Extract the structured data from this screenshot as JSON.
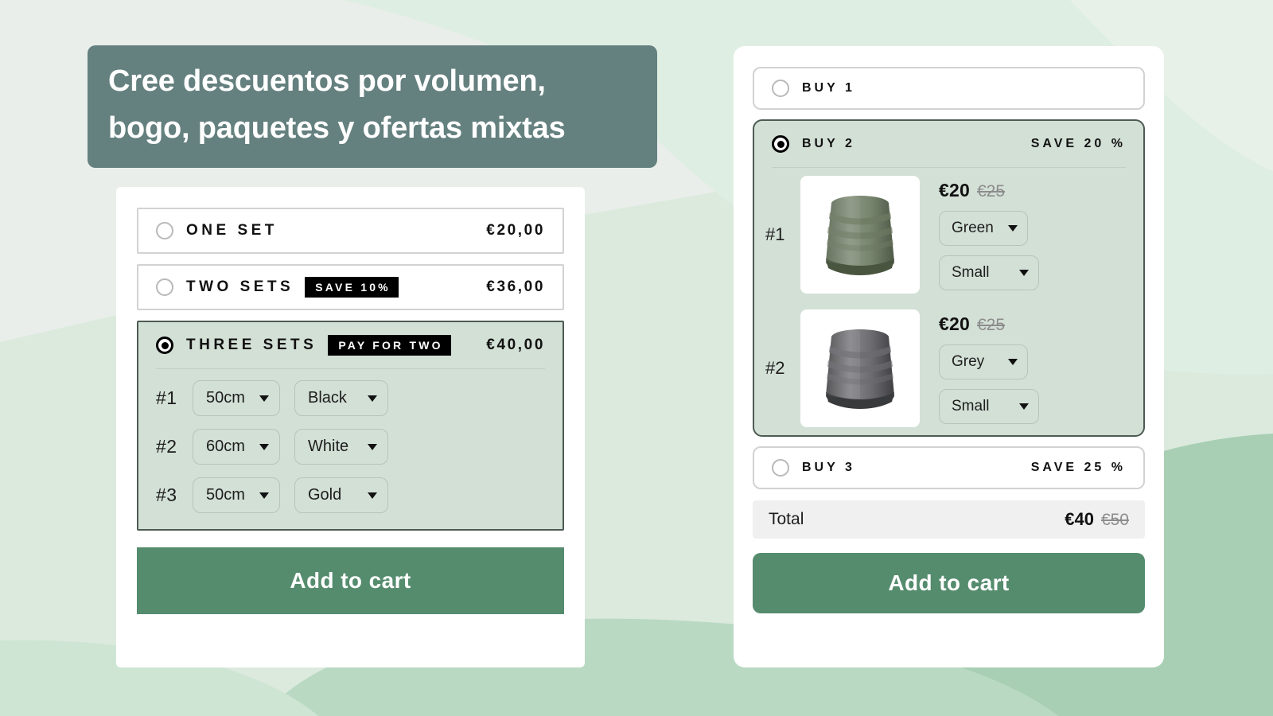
{
  "headline": {
    "line1": "Cree descuentos por volumen,",
    "line2": "bogo, paquetes y ofertas mixtas",
    "bg_color": "#64807f",
    "text_color": "#ffffff"
  },
  "colors": {
    "page_bg": "#e9eeea",
    "accent_green": "#558c6e",
    "selected_panel_bg": "#d3e0d6",
    "selected_border": "#4d5b54",
    "badge_bg": "#000000",
    "total_bg": "#f0f0f0",
    "strikethrough": "#8c8c8c"
  },
  "left_card": {
    "options": [
      {
        "label": "ONE SET",
        "badge": null,
        "price": "€20,00",
        "selected": false
      },
      {
        "label": "TWO SETS",
        "badge": "SAVE 10%",
        "price": "€36,00",
        "selected": false
      },
      {
        "label": "THREE SETS",
        "badge": "PAY FOR TWO",
        "price": "€40,00",
        "selected": true
      }
    ],
    "variant_rows": [
      {
        "num": "#1",
        "size": "50cm",
        "color": "Black"
      },
      {
        "num": "#2",
        "size": "60cm",
        "color": "White"
      },
      {
        "num": "#3",
        "size": "50cm",
        "color": "Gold"
      }
    ],
    "cta_label": "Add to cart"
  },
  "right_card": {
    "options": [
      {
        "label": "BUY 1",
        "save": "",
        "selected": false
      },
      {
        "label": "BUY 2",
        "save": "SAVE 20 %",
        "selected": true
      },
      {
        "label": "BUY 3",
        "save": "SAVE 25 %",
        "selected": false
      }
    ],
    "products": [
      {
        "num": "#1",
        "price_now": "€20",
        "price_was": "€25",
        "color": "Green",
        "size": "Small",
        "image": "green-neck-gaiter"
      },
      {
        "num": "#2",
        "price_now": "€20",
        "price_was": "€25",
        "color": "Grey",
        "size": "Small",
        "image": "grey-neck-gaiter"
      }
    ],
    "total": {
      "label": "Total",
      "now": "€40",
      "was": "€50"
    },
    "cta_label": "Add to cart"
  }
}
